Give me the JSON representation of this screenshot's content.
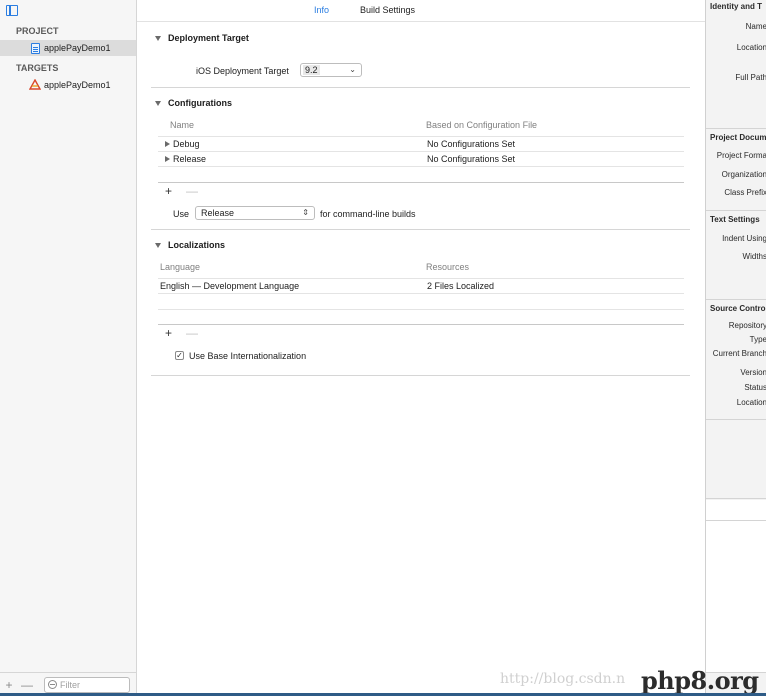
{
  "navigator": {
    "project_header": "PROJECT",
    "project_item": "applePayDemo1",
    "targets_header": "TARGETS",
    "target_item": "applePayDemo1",
    "add_symbol": "+",
    "remove_symbol": "—",
    "filter_placeholder": "Filter"
  },
  "tabs": {
    "info": "Info",
    "build_settings": "Build Settings"
  },
  "deployment": {
    "title": "Deployment Target",
    "label": "iOS Deployment Target",
    "value": "9.2"
  },
  "configurations": {
    "title": "Configurations",
    "columns": [
      "Name",
      "Based on Configuration File"
    ],
    "rows": [
      {
        "name": "Debug",
        "file": "No Configurations Set"
      },
      {
        "name": "Release",
        "file": "No Configurations Set"
      }
    ],
    "add": "+",
    "remove": "—",
    "use_label": "Use",
    "use_value": "Release",
    "use_suffix": "for command-line builds"
  },
  "localizations": {
    "title": "Localizations",
    "columns": [
      "Language",
      "Resources"
    ],
    "rows": [
      {
        "language": "English — Development Language",
        "resources": "2 Files Localized"
      }
    ],
    "add": "+",
    "remove": "—",
    "base_checkbox": "Use Base Internationalization"
  },
  "inspector": {
    "identity_head": "Identity and T",
    "name": "Name",
    "location": "Location",
    "full_path": "Full Path",
    "project_doc_head": "Project Docum",
    "project_format": "Project Forma",
    "organization": "Organization",
    "class_prefix": "Class Prefix",
    "text_settings_head": "Text Settings",
    "indent_using": "Indent Using",
    "widths": "Widths",
    "source_control_head": "Source Contro",
    "repository": "Repository",
    "type": "Type",
    "current_branch": "Current Branch",
    "version": "Version",
    "status": "Status",
    "location2": "Location"
  },
  "watermark": "http://blog.csdn.n",
  "brand": "php8.org"
}
